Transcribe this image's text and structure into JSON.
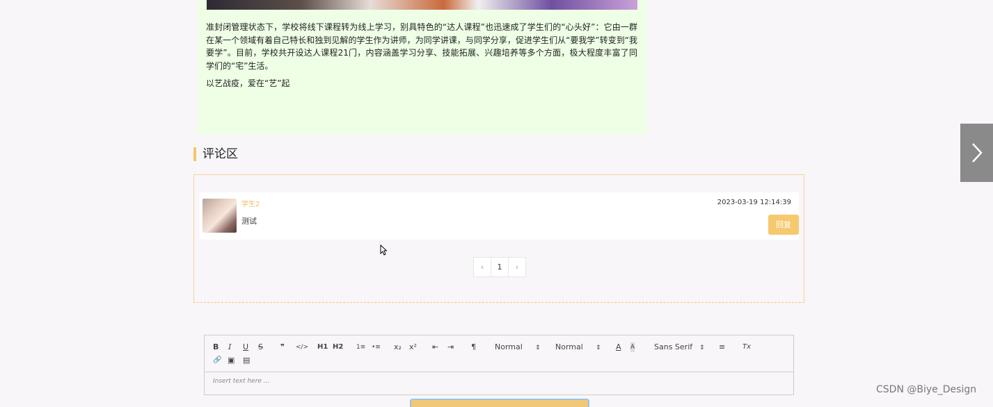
{
  "article": {
    "paragraph1": "准封闭管理状态下，学校将线下课程转为线上学习，别具特色的“达人课程”也迅速成了学生们的“心头好”：它由一群在某一个领域有着自己特长和独到见解的学生作为讲师，为同学讲课，与同学分享，促进学生们从“要我学”转变到“我要学”。目前，学校共开设达人课程21门，内容涵盖学习分享、技能拓展、兴趣培养等多个方面，极大程度丰富了同学们的“宅”生活。",
    "paragraph2": "以艺战疫，爱在“艺”起"
  },
  "comments_section": {
    "title": "评论区",
    "comments": [
      {
        "author": "学生2",
        "text": "测试",
        "time": "2023-03-19 12:14:39",
        "reply_label": "回复"
      }
    ],
    "pagination": {
      "prev": "‹",
      "current": "1",
      "next": "›"
    }
  },
  "editor": {
    "toolbar": {
      "bold": "B",
      "italic": "I",
      "underline": "U",
      "strike": "S",
      "blockquote": "❞",
      "code": "</>",
      "h1": "H1",
      "h2": "H2",
      "ordered_list": "1≡",
      "bullet_list": "•≡",
      "subscript": "x₂",
      "superscript": "x²",
      "outdent": "⇤",
      "indent": "⇥",
      "direction": "¶",
      "size_picker": "Normal",
      "header_picker": "Normal",
      "font_picker": "Sans Serif",
      "color": "A",
      "background": "A",
      "align": "≡",
      "clean": "Tx",
      "link": "🔗",
      "image": "▣",
      "video": "▤"
    },
    "placeholder": "Insert text here ..."
  },
  "watermark": "CSDN @Biye_Design",
  "colors": {
    "accent": "#f5c66a",
    "article_bg": "#eeffe6",
    "page_bg": "#f8f6f9"
  }
}
